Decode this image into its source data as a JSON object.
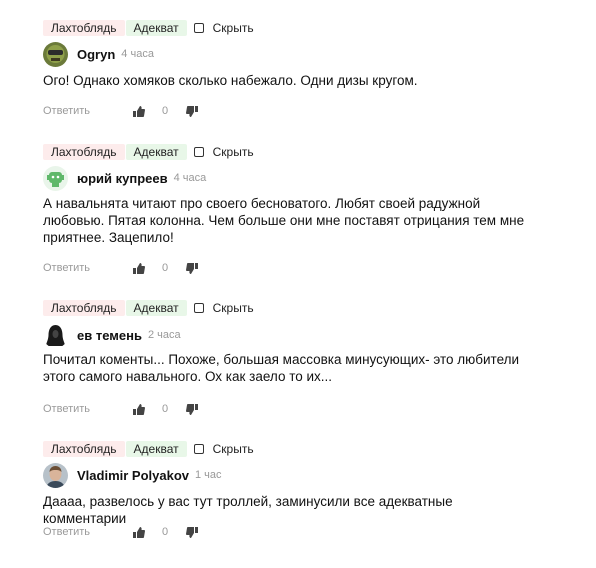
{
  "labels": {
    "tag_bad": "Лахтоблядь",
    "tag_good": "Адекват",
    "hide": "Скрыть",
    "reply": "Ответить"
  },
  "comments": [
    {
      "author": "Ogryn",
      "time": "4 часа",
      "text": "Ого! Однако хомяков сколько набежало. Одни дизы кругом.",
      "votes": "0",
      "avatar_icon": "ogryn-avatar"
    },
    {
      "author": "юрий купреев",
      "time": "4 часа",
      "text": "А навальнята читают про своего бесноватого. Любят своей радужной любовью. Пятая колонна. Чем больше они мне поставят отрицания тем мне приятнее. Зацепило!",
      "votes": "0",
      "avatar_icon": "green-robot-avatar"
    },
    {
      "author": "ев темень",
      "time": "2 часа",
      "text": "Почитал коменты... Похоже, большая массовка минусующих- это любители этого самого навального. Ох как заело то их...",
      "votes": "0",
      "avatar_icon": "hooded-figure-avatar"
    },
    {
      "author": "Vladimir Polyakov",
      "time": "1 час",
      "text": "Даааа, развелось у вас тут троллей, заминусили все адекватные комментарии",
      "votes": "0",
      "avatar_icon": "photo-avatar"
    }
  ],
  "colors": {
    "tag_bad_bg": "#fdecec",
    "tag_good_bg": "#e8f7e8",
    "muted": "#999999"
  }
}
